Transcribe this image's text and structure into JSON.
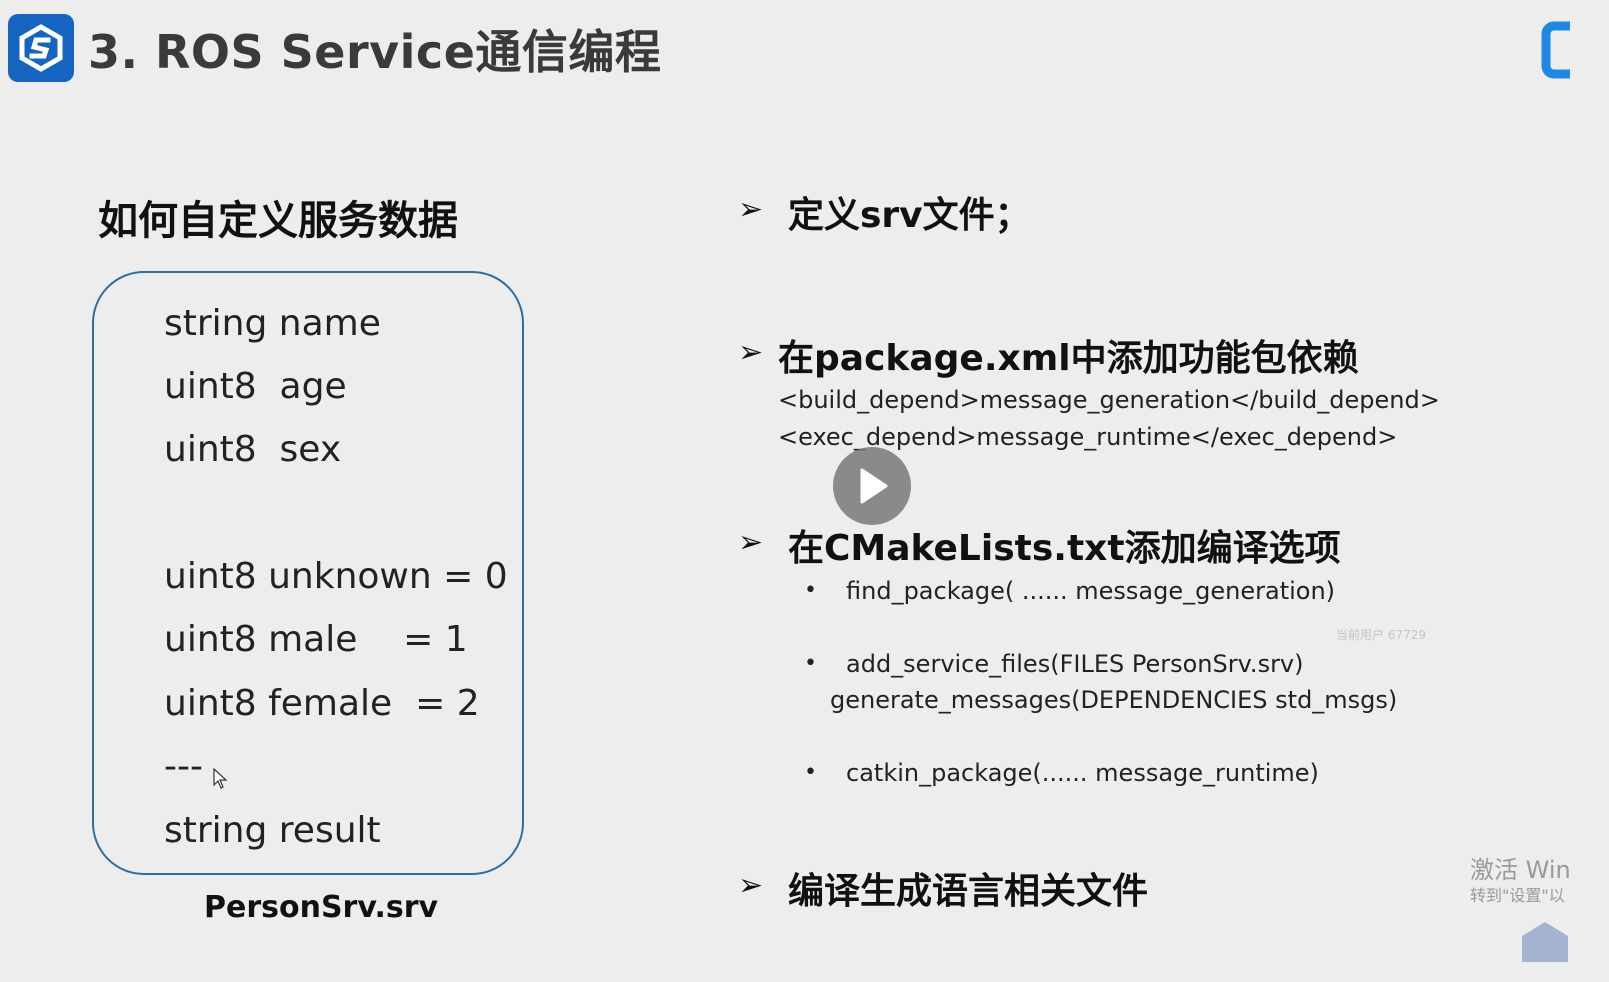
{
  "header": {
    "title": "3. ROS Service通信编程"
  },
  "left": {
    "heading": "如何自定义服务数据",
    "srv_lines": [
      "string name",
      "uint8  age",
      "uint8  sex",
      "uint8 unknown = 0",
      "uint8 male    = 1",
      "uint8 female  = 2",
      "---",
      "string result"
    ],
    "caption": "PersonSrv.srv"
  },
  "right": {
    "step1": "定义srv文件；",
    "step2": "在package.xml中添加功能包依赖",
    "step2_code": [
      "<build_depend>message_generation</build_depend>",
      "<exec_depend>message_runtime</exec_depend>"
    ],
    "step3": "在CMakeLists.txt添加编译选项",
    "step3_bullets": [
      "find_package( ......  message_generation)",
      "add_service_files(FILES PersonSrv.srv)",
      "generate_messages(DEPENDENCIES std_msgs)",
      "catkin_package(...... message_runtime)"
    ],
    "step4": "编译生成语言相关文件"
  },
  "overlay": {
    "watermark_user": "当前用户 67729",
    "activate_line1": "激活 Win",
    "activate_line2": "转到\"设置\"以"
  },
  "colors": {
    "brand_blue": "#1565c0",
    "box_border": "#2d6ea3"
  },
  "icons": {
    "logo": "brand-logo-icon",
    "arrow": "arrow-bullet-icon",
    "play": "play-icon",
    "cursor": "mouse-cursor-icon"
  }
}
